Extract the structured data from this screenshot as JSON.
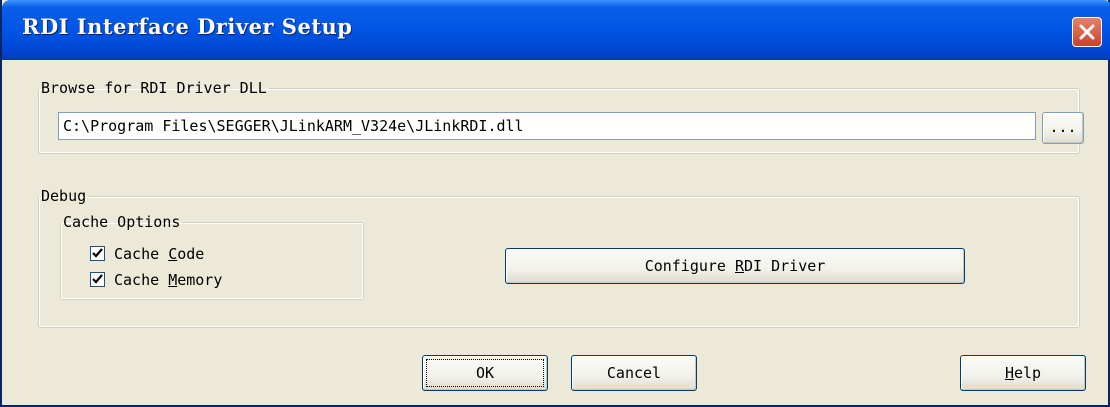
{
  "window": {
    "title": "RDI Interface Driver Setup",
    "close_icon": "close-icon"
  },
  "browse_group": {
    "legend": "Browse for RDI Driver DLL",
    "path_value": "C:\\Program Files\\SEGGER\\JLinkARM_V324e\\JLinkRDI.dll",
    "browse_label": "..."
  },
  "debug_group": {
    "legend": "Debug",
    "cache_options": {
      "legend": "Cache Options",
      "cache_code": {
        "label_pre": "Cache ",
        "label_key": "C",
        "label_post": "ode",
        "checked": true
      },
      "cache_memory": {
        "label_pre": "Cache ",
        "label_key": "M",
        "label_post": "emory",
        "checked": true
      }
    },
    "configure": {
      "label_pre": "Configure ",
      "label_key": "R",
      "label_post": "DI Driver"
    }
  },
  "footer": {
    "ok_label": "OK",
    "cancel_label": "Cancel",
    "help": {
      "label_key": "H",
      "label_post": "elp"
    }
  },
  "colors": {
    "titlebar": "#0055e5",
    "dialog_bg": "#ece9d8",
    "close_button": "#c8422a"
  }
}
